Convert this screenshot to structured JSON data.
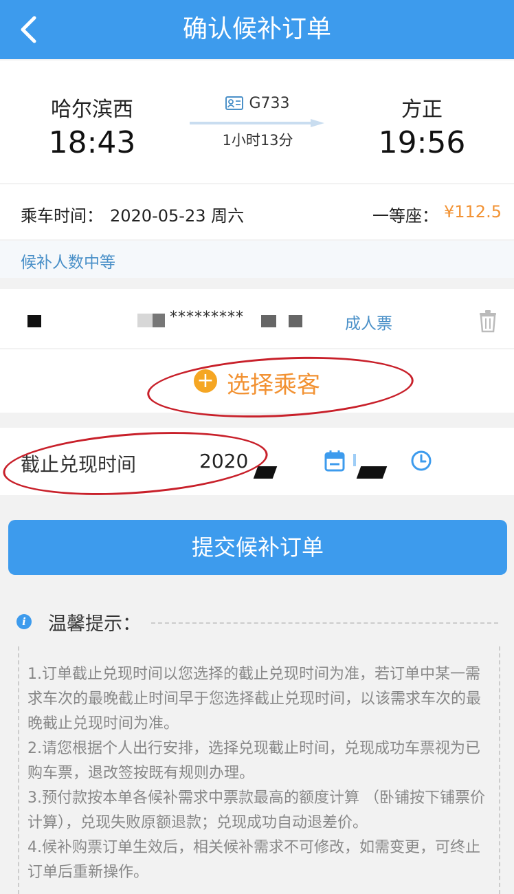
{
  "header": {
    "title": "确认候补订单"
  },
  "train": {
    "from_station": "哈尔滨西",
    "depart_time": "18:43",
    "train_no": "G733",
    "duration": "1小时13分",
    "to_station": "方正",
    "arrive_time": "19:56"
  },
  "trip": {
    "date_label": "乘车时间：",
    "date_value": "2020-05-23 周六",
    "seat_label": "一等座：",
    "price": "¥112.5",
    "status": "候补人数中等"
  },
  "passenger": {
    "id_masked": "*********",
    "ticket_type": "成人票"
  },
  "select_passenger": {
    "label": "选择乘客",
    "plus": "+"
  },
  "deadline": {
    "label": "截止兑现时间",
    "value": "2020"
  },
  "submit": {
    "label": "提交候补订单"
  },
  "tips": {
    "title": "温馨提示：",
    "items": [
      "1.订单截止兑现时间以您选择的截止兑现时间为准，若订单中某一需求车次的最晚截止时间早于您选择截止兑现时间，以该需求车次的最晚截止兑现时间为准。",
      "2.请您根据个人出行安排，选择兑现截止时间，兑现成功车票视为已购车票，退改签按既有规则办理。",
      "3.预付款按本单各候补需求中票款最高的额度计算 （卧铺按下铺票价计算），兑现失败原额退款；兑现成功自动退差价。",
      "4.候补购票订单生效后，相关候补需求不可修改，如需变更，可终止订单后重新操作。"
    ]
  },
  "colors": {
    "primary": "#3d9bed",
    "accent": "#f29233",
    "annotation": "#c8202a"
  },
  "icons": [
    "back-arrow-icon",
    "id-card-icon",
    "trash-icon",
    "plus-icon",
    "calendar-icon",
    "clock-icon",
    "info-icon"
  ]
}
